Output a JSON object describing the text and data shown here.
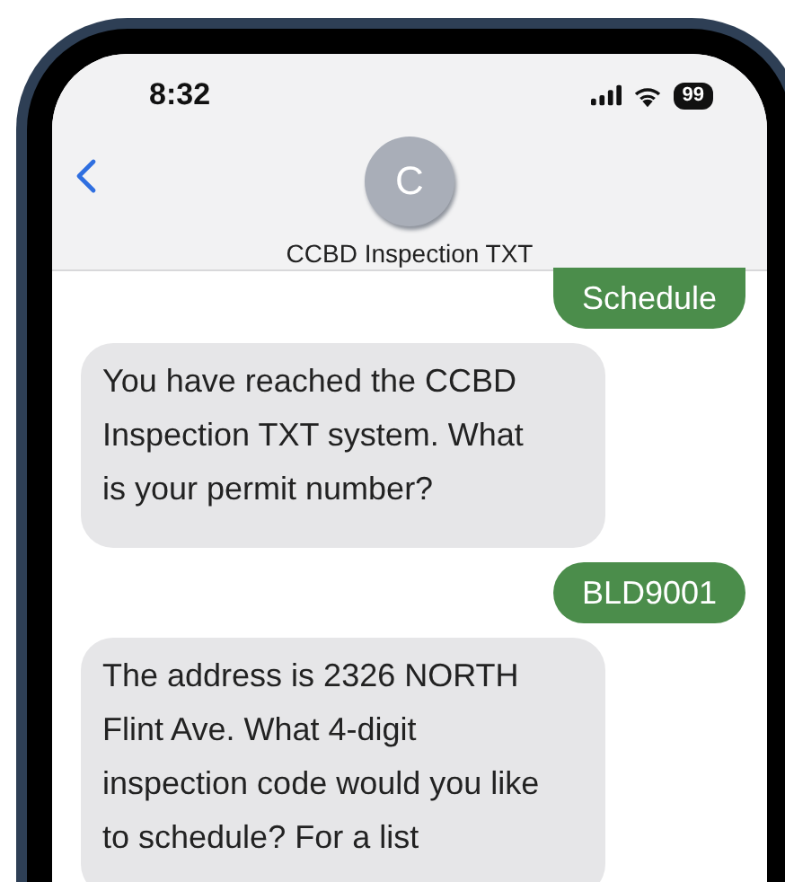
{
  "status_bar": {
    "time": "8:32",
    "battery": "99"
  },
  "header": {
    "avatar_letter": "C",
    "contact_name": "CCBD Inspection TXT"
  },
  "messages": [
    {
      "kind": "sent",
      "text": "Schedule"
    },
    {
      "kind": "received",
      "text": "You have reached the CCBD Inspection TXT system. What is your permit number?"
    },
    {
      "kind": "sent",
      "text": "BLD9001"
    },
    {
      "kind": "received",
      "text": "The address is 2326 NORTH Flint Ave. What 4-digit inspection code would you like to schedule? For a list"
    }
  ]
}
